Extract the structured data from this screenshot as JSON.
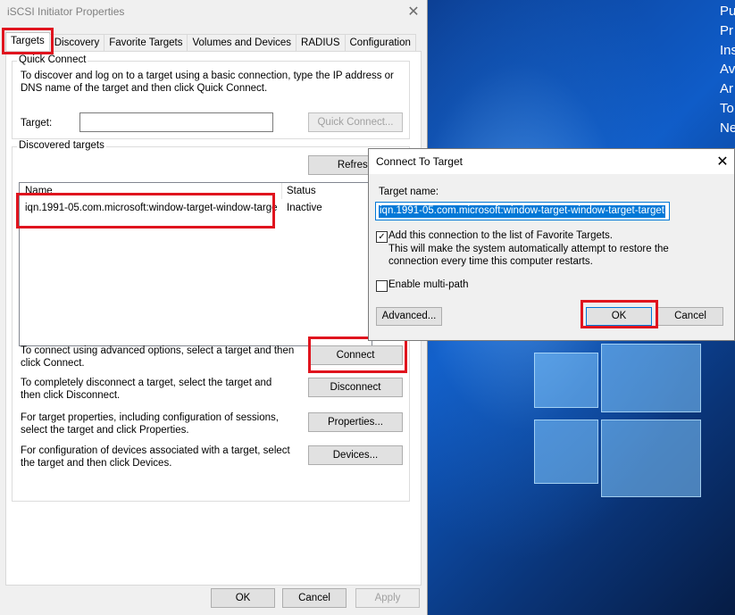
{
  "desktop": {
    "menu_lines": [
      "Pu",
      "Pr",
      "Ins",
      "Av",
      "Ar",
      "To",
      "Ne"
    ]
  },
  "main_dialog": {
    "title": "iSCSI Initiator Properties",
    "tabs": [
      "Targets",
      "Discovery",
      "Favorite Targets",
      "Volumes and Devices",
      "RADIUS",
      "Configuration"
    ],
    "quick_connect": {
      "legend": "Quick Connect",
      "description_line1": "To discover and log on to a target using a basic connection, type the IP address or",
      "description_line2": "DNS name of the target and then click Quick Connect.",
      "target_label": "Target:",
      "target_value": "",
      "button": "Quick Connect..."
    },
    "discovered": {
      "legend": "Discovered targets",
      "refresh_button": "Refresh",
      "columns": [
        "Name",
        "Status"
      ],
      "rows": [
        {
          "name": "iqn.1991-05.com.microsoft:window-target-window-targe...",
          "status": "Inactive"
        }
      ]
    },
    "actions": [
      {
        "line1": "To connect using advanced options, select a target and then",
        "line2": "click Connect.",
        "button": "Connect"
      },
      {
        "line1": "To completely disconnect a target, select the target and",
        "line2": "then click Disconnect.",
        "button": "Disconnect"
      },
      {
        "line1": "For target properties, including configuration of sessions,",
        "line2": "select the target and click Properties.",
        "button": "Properties..."
      },
      {
        "line1": "For configuration of devices associated with a target, select",
        "line2": "the target and then click Devices.",
        "button": "Devices..."
      }
    ],
    "footer": {
      "ok": "OK",
      "cancel": "Cancel",
      "apply": "Apply"
    }
  },
  "connect_dialog": {
    "title": "Connect To Target",
    "target_name_label": "Target name:",
    "target_name_value": "iqn.1991-05.com.microsoft:window-target-window-target-target",
    "favorite_checkbox_label": "Add this connection to the list of Favorite Targets.",
    "favorite_checked": true,
    "favorite_note_line1": "This will make the system automatically attempt to restore the",
    "favorite_note_line2": "connection every time this computer restarts.",
    "multipath_label": "Enable multi-path",
    "multipath_checked": false,
    "advanced_button": "Advanced...",
    "ok_button": "OK",
    "cancel_button": "Cancel"
  },
  "colors": {
    "highlight": "#e0141e",
    "selection": "#0078d7"
  }
}
